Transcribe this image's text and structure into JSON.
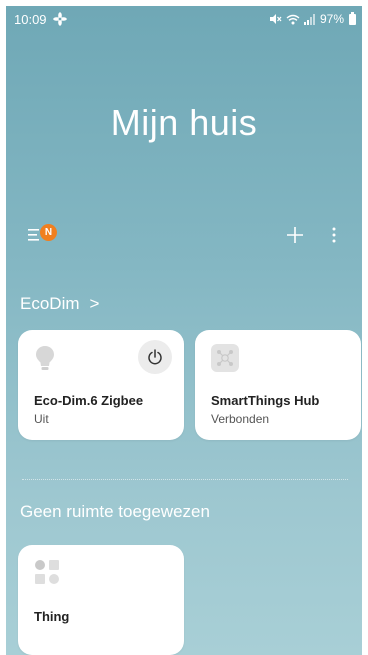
{
  "status_bar": {
    "time": "10:09",
    "battery": "97%",
    "left_icon": "fan-icon",
    "right_icons": [
      "mute-icon",
      "wifi-icon",
      "signal-icon",
      "battery-icon"
    ]
  },
  "header": {
    "title": "Mijn huis",
    "badge": "N"
  },
  "room": {
    "name": "EcoDim",
    "arrow": ">"
  },
  "devices": [
    {
      "name": "Eco-Dim.6 Zigbee",
      "status": "Uit",
      "icon": "bulb-icon"
    },
    {
      "name": "SmartThings Hub",
      "status": "Verbonden",
      "icon": "hub-icon"
    }
  ],
  "unassigned": {
    "title": "Geen ruimte toegewezen",
    "devices": [
      {
        "name": "Thing",
        "icon": "thing-icon"
      }
    ]
  },
  "colors": {
    "background_top": "#6fa8b6",
    "background_bottom": "#a8cfd6",
    "badge": "#f07f1f",
    "card": "#ffffff"
  }
}
